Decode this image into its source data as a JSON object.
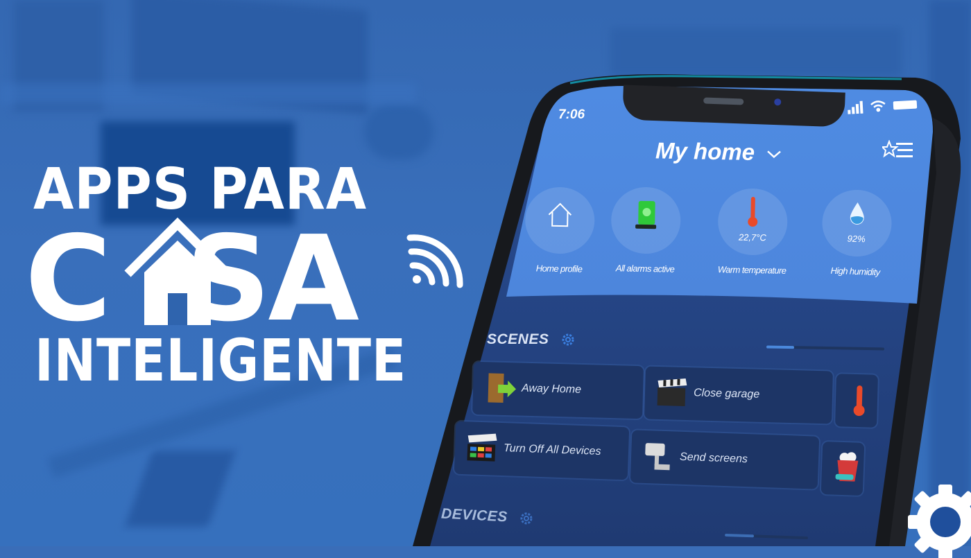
{
  "headline": {
    "line1": "APPS PARA",
    "casa_left": "C",
    "casa_right": "SA",
    "line3": "INTELIGENTE",
    "house_icon": "house-icon",
    "wifi_icon": "wifi-icon"
  },
  "phone": {
    "status_bar": {
      "time": "7:06",
      "icons": [
        "signal-icon",
        "wifi-icon",
        "battery-icon"
      ]
    },
    "header": {
      "title": "My home",
      "dropdown_icon": "chevron-down-icon",
      "menu_icon": "favorites-menu-icon"
    },
    "stats": [
      {
        "icon": "home-outline-icon",
        "value": "",
        "label": "Home profile"
      },
      {
        "icon": "green-alarm-icon",
        "value": "",
        "label": "All alarms active"
      },
      {
        "icon": "thermometer-icon",
        "value": "22,7°C",
        "label": "Warm temperature"
      },
      {
        "icon": "water-drop-icon",
        "value": "92%",
        "label": "High humidity"
      }
    ],
    "scenes": {
      "title": "SCENES",
      "settings_icon": "gear-icon",
      "items": [
        {
          "icon": "door-exit-icon",
          "label": "Away Home"
        },
        {
          "icon": "clapperboard-icon",
          "label": "Close garage"
        },
        {
          "icon": "thermometer-icon",
          "label": ""
        },
        {
          "icon": "clapperboard-color-icon",
          "label": "Turn Off All Devices"
        },
        {
          "icon": "security-camera-icon",
          "label": "Send screens"
        },
        {
          "icon": "popcorn-icon",
          "label": ""
        }
      ]
    },
    "devices": {
      "title": "DEVICES",
      "settings_icon": "gear-icon"
    }
  },
  "corner_badge": {
    "icon": "gear-icon"
  },
  "colors": {
    "background": "#3a6db8",
    "app_header": "#4f8ae0",
    "app_body": "#253f78",
    "card": "#1d3566",
    "text": "#ffffff"
  }
}
